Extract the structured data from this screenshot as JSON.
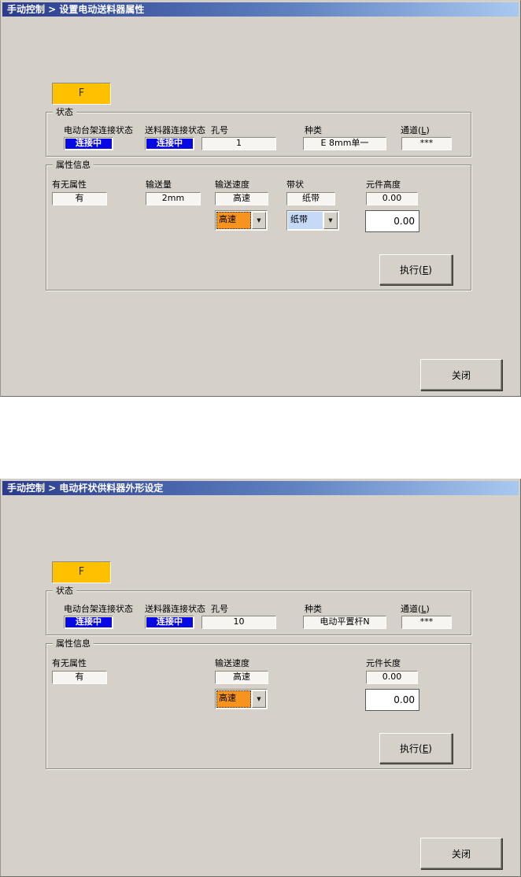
{
  "colors": {
    "titlebar_left": "#2B3C8E",
    "titlebar_right": "#A9C8F0",
    "dialog_bg": "#D5D1C9",
    "status_blue": "#0808E6",
    "f_button_orange": "#FFC000",
    "combo_highlight_orange": "#F7941E",
    "combo_light_blue": "#C6D9F7"
  },
  "icons": {
    "dropdown_arrow": "▼"
  },
  "window1": {
    "title": "手动控制 > 设置电动送料器属性",
    "f_button": "F",
    "status": {
      "title": "状态",
      "stand_label": "电动台架连接状态",
      "stand_value": "连接中",
      "feeder_label": "送料器连接状态",
      "feeder_value": "连接中",
      "hole_label": "孔号",
      "hole_value": "1",
      "kind_label": "种类",
      "kind_value": "E 8mm单一",
      "channel_label_pre": "通道(",
      "channel_label_key": "L",
      "channel_label_post": ")",
      "channel_value": "***"
    },
    "attributes": {
      "title": "属性信息",
      "has_attr_label": "有无属性",
      "has_attr_value": "有",
      "feed_amount_label": "输送量",
      "feed_amount_value": "2mm",
      "feed_speed_label": "输送速度",
      "feed_speed_value": "高速",
      "feed_speed_selected": "高速",
      "tape_label": "带状",
      "tape_value": "纸带",
      "tape_selected": "纸带",
      "height_label": "元件高度",
      "height_value": "0.00",
      "height_input": "0.00",
      "execute_pre": "执行(",
      "execute_key": "E",
      "execute_post": ")"
    },
    "close_button": "关闭"
  },
  "window2": {
    "title": "手动控制 > 电动杆状供料器外形设定",
    "f_button": "F",
    "status": {
      "title": "状态",
      "stand_label": "电动台架连接状态",
      "stand_value": "连接中",
      "feeder_label": "送料器连接状态",
      "feeder_value": "连接中",
      "hole_label": "孔号",
      "hole_value": "10",
      "kind_label": "种类",
      "kind_value": "电动平置杆N",
      "channel_label_pre": "通道(",
      "channel_label_key": "L",
      "channel_label_post": ")",
      "channel_value": "***"
    },
    "attributes": {
      "title": "属性信息",
      "has_attr_label": "有无属性",
      "has_attr_value": "有",
      "feed_speed_label": "输送速度",
      "feed_speed_value": "高速",
      "feed_speed_selected": "高速",
      "length_label": "元件长度",
      "length_value": "0.00",
      "length_input": "0.00",
      "execute_pre": "执行(",
      "execute_key": "E",
      "execute_post": ")"
    },
    "close_button": "关闭"
  }
}
